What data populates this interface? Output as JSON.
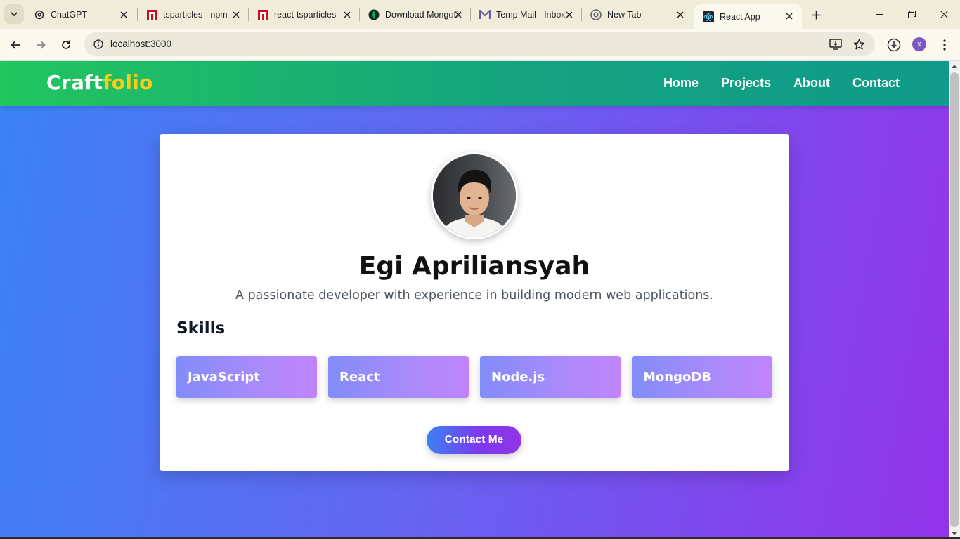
{
  "browser": {
    "tabs": [
      {
        "title": "ChatGPT",
        "icon": "chatgpt-icon"
      },
      {
        "title": "tsparticles - npm",
        "icon": "npm-icon"
      },
      {
        "title": "react-tsparticles",
        "icon": "npm-icon"
      },
      {
        "title": "Download MongoDB",
        "icon": "mongodb-icon"
      },
      {
        "title": "Temp Mail - Inbox",
        "icon": "tempmail-icon"
      },
      {
        "title": "New Tab",
        "icon": "chrome-icon"
      },
      {
        "title": "React App",
        "icon": "react-icon"
      }
    ],
    "active_tab_index": 6,
    "url": "localhost:3000",
    "profile_initial": "x"
  },
  "site": {
    "logo_part1": "Craft",
    "logo_part2": "folio",
    "nav": [
      "Home",
      "Projects",
      "About",
      "Contact"
    ],
    "profile": {
      "name": "Egi Apriliansyah",
      "tagline": "A passionate developer with experience in building modern web applications."
    },
    "skills_heading": "Skills",
    "skills": [
      "JavaScript",
      "React",
      "Node.js",
      "MongoDB"
    ],
    "contact_button": "Contact Me"
  },
  "colors": {
    "header_gradient": [
      "#22c55e",
      "#0f9a8a"
    ],
    "page_gradient": [
      "#3b82f6",
      "#9333ea"
    ],
    "logo_accent": "#facc15"
  }
}
